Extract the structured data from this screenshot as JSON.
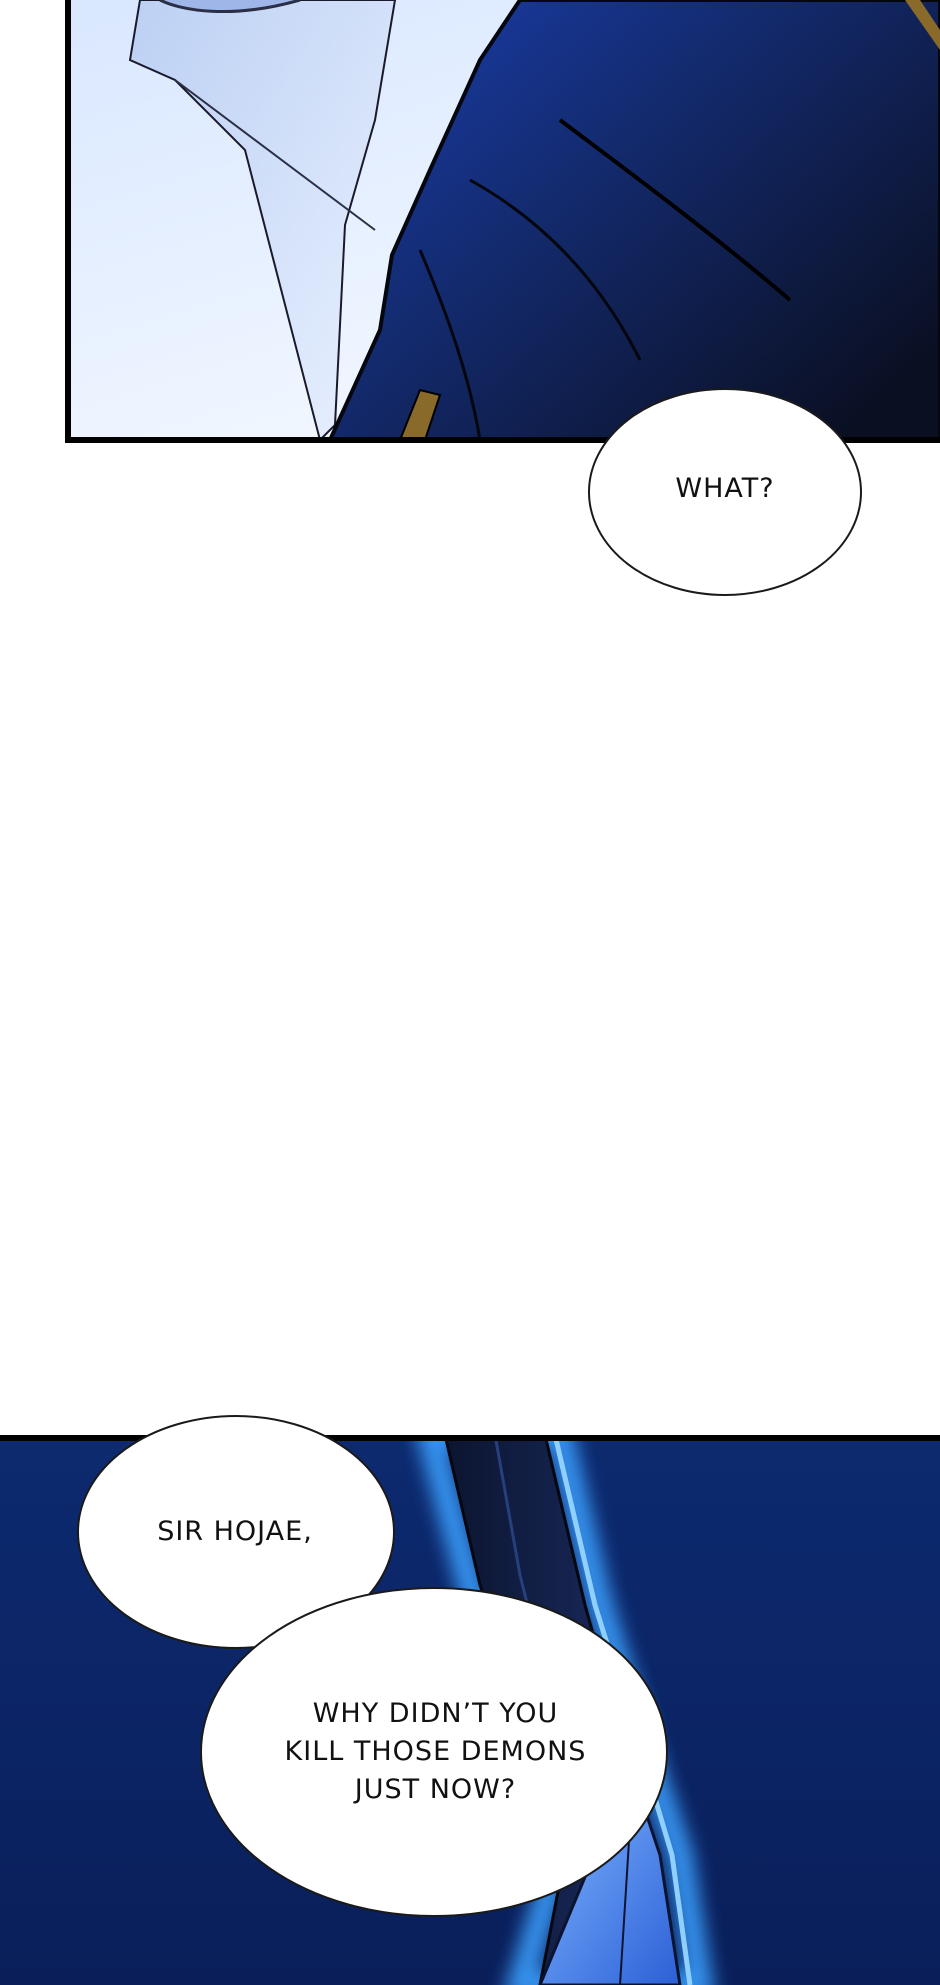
{
  "comic": {
    "bubbles": {
      "what": "WHAT?",
      "sir_hojae": "SIR HOJAE,",
      "why_line1": "WHY DIDN’T YOU",
      "why_line2": "KILL THOSE DEMONS",
      "why_line3": "JUST NOW?"
    }
  },
  "colors": {
    "panel_border": "#000000",
    "night_blue": "#0c2a6e",
    "glow_blue": "#2f8dff",
    "bubble_fill": "#ffffff",
    "bubble_stroke": "#1a1a1a",
    "gold_trim": "#8a6a2a"
  }
}
